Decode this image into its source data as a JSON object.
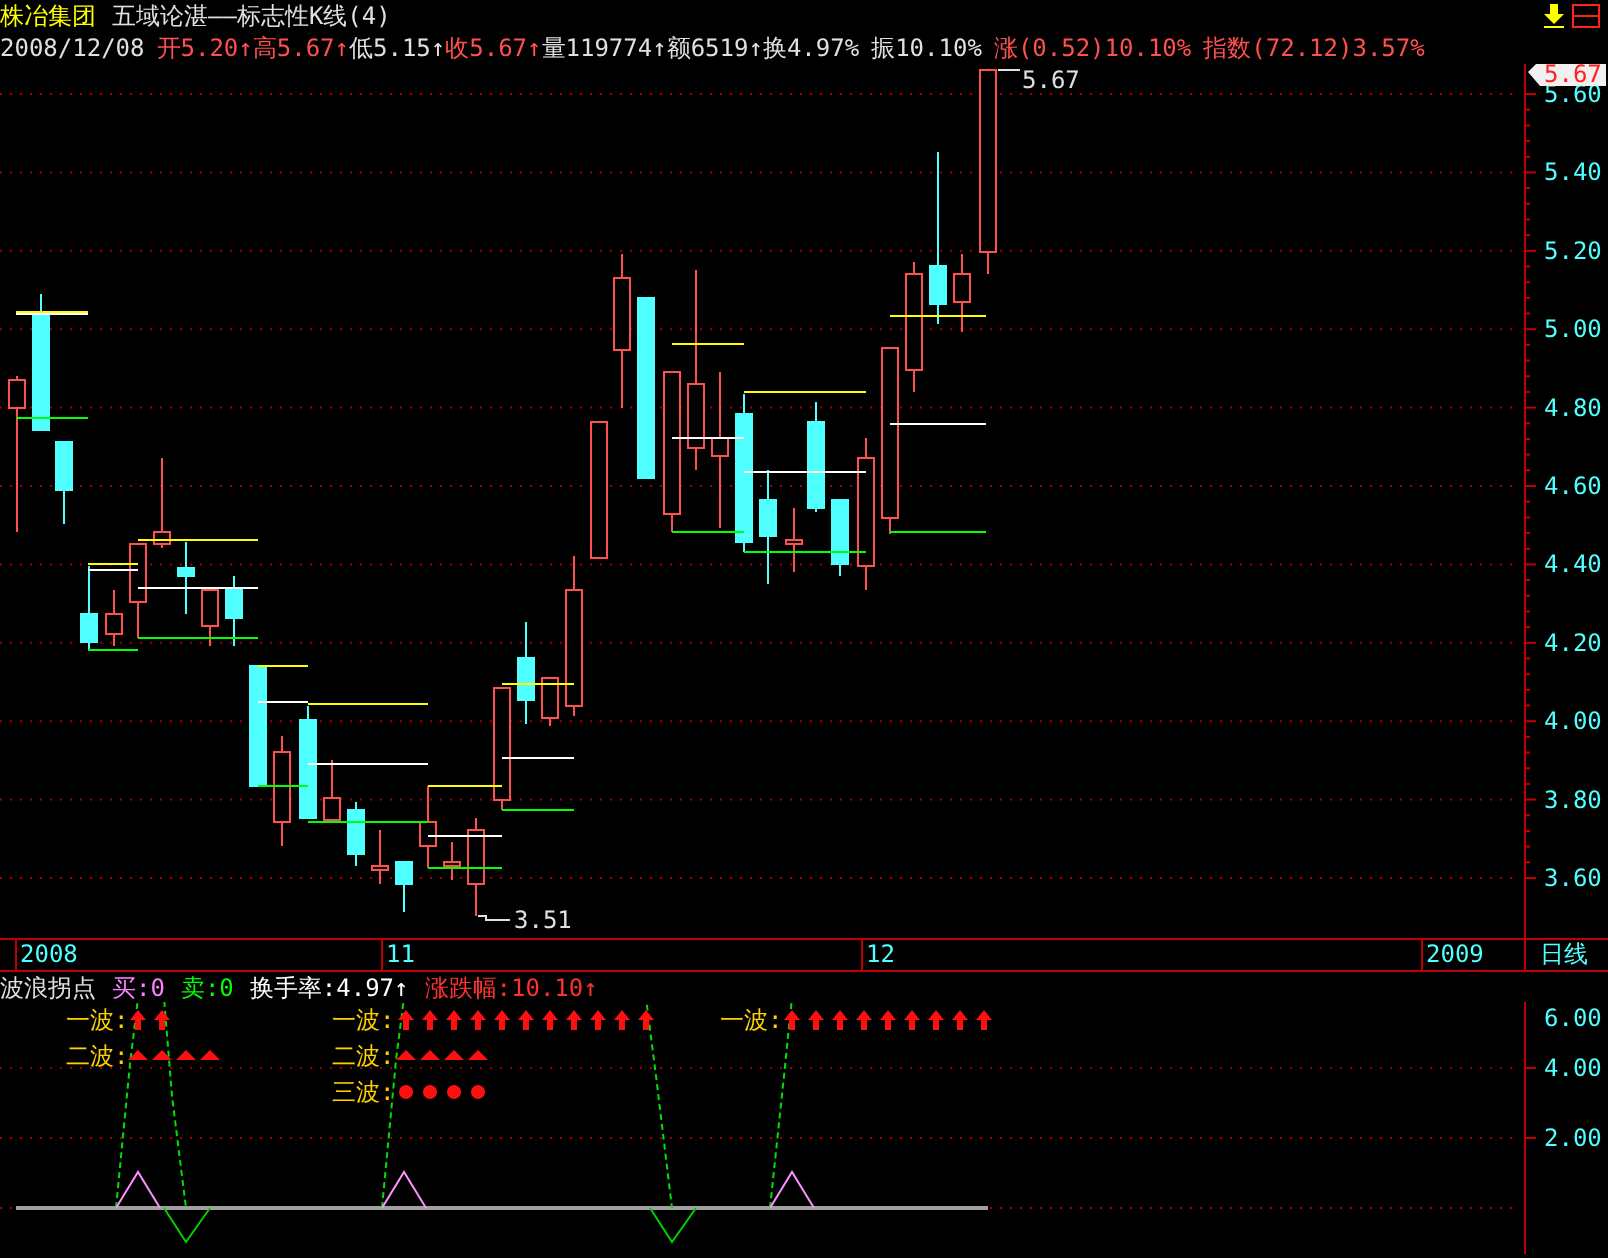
{
  "header": {
    "stock_name": "株冶集团",
    "indicator_title": "五域论湛——标志性K线(4)"
  },
  "quote": [
    {
      "text": "2008/12/08",
      "color": "#e0e0e0"
    },
    {
      "text": "开5.20↑",
      "color": "#ff5050"
    },
    {
      "text": "高5.67↑",
      "color": "#ff5050"
    },
    {
      "text": "低5.15↑",
      "color": "#e0e0e0"
    },
    {
      "text": "收5.67↑",
      "color": "#ff5050"
    },
    {
      "text": "量119774↑",
      "color": "#e0e0e0"
    },
    {
      "text": "额6519↑",
      "color": "#e0e0e0"
    },
    {
      "text": "换4.97%",
      "color": "#e0e0e0"
    },
    {
      "text": "振10.10%",
      "color": "#e0e0e0"
    },
    {
      "text": "涨(0.52)10.10%",
      "color": "#ff5050"
    },
    {
      "text": "指数(72.12)3.57%",
      "color": "#ff5050"
    }
  ],
  "price_axis": {
    "current_price": "5.67",
    "labels": [
      "5.60",
      "5.40",
      "5.20",
      "5.00",
      "4.80",
      "4.60",
      "4.40",
      "4.20",
      "4.00",
      "3.80",
      "3.60"
    ]
  },
  "chart_labels": {
    "high": "5.67",
    "low": "3.51"
  },
  "date_axis": {
    "labels": [
      "2008",
      "11",
      "12",
      "2009"
    ],
    "period": "日线"
  },
  "indicator": {
    "title": "波浪拐点",
    "values": [
      {
        "text": "买:0",
        "color": "#ff80ff"
      },
      {
        "text": "卖:0",
        "color": "#00ff00"
      },
      {
        "text": "换手率:4.97↑",
        "color": "#ffffff"
      },
      {
        "text": "涨跌幅:10.10↑",
        "color": "#ff3030"
      }
    ],
    "axis_labels": [
      "6.00",
      "4.00",
      "2.00"
    ],
    "wave_groups": [
      {
        "rows": [
          {
            "label": "一波:",
            "kind": "arrow"
          },
          {
            "label": "二波:",
            "kind": "triangle"
          }
        ]
      },
      {
        "rows": [
          {
            "label": "一波:",
            "kind": "arrow"
          },
          {
            "label": "二波:",
            "kind": "triangle"
          },
          {
            "label": "三波:",
            "kind": "dot"
          }
        ]
      },
      {
        "rows": [
          {
            "label": "一波:",
            "kind": "arrow"
          }
        ]
      }
    ]
  }
}
